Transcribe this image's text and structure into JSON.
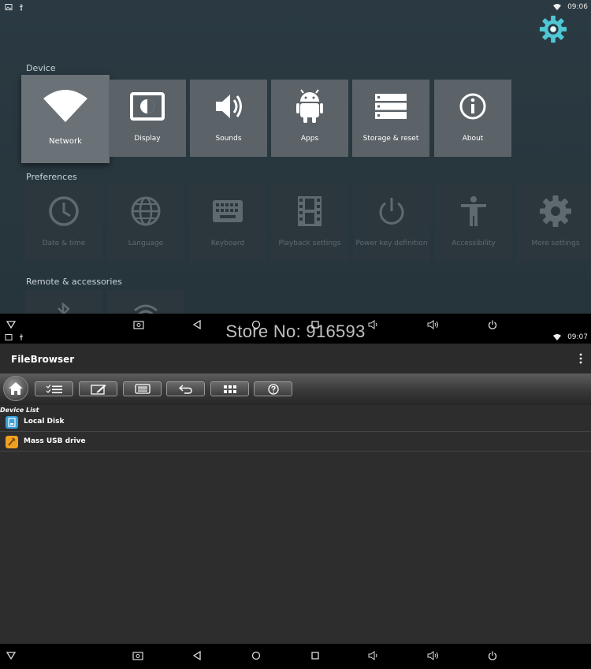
{
  "top_screen": {
    "status": {
      "time": "09:06"
    },
    "sections": {
      "device": "Device",
      "preferences": "Preferences",
      "remote": "Remote & accessories"
    },
    "device_tiles": [
      {
        "label": "Network",
        "icon": "wifi-icon"
      },
      {
        "label": "Display",
        "icon": "display-icon"
      },
      {
        "label": "Sounds",
        "icon": "speaker-icon"
      },
      {
        "label": "Apps",
        "icon": "android-icon"
      },
      {
        "label": "Storage & reset",
        "icon": "storage-icon"
      },
      {
        "label": "About",
        "icon": "info-icon"
      }
    ],
    "preference_tiles": [
      {
        "label": "Date & time",
        "icon": "clock-icon"
      },
      {
        "label": "Language",
        "icon": "globe-icon"
      },
      {
        "label": "Keyboard",
        "icon": "keyboard-icon"
      },
      {
        "label": "Playback settings",
        "icon": "film-icon"
      },
      {
        "label": "Power key definition",
        "icon": "power-icon"
      },
      {
        "label": "Accessibility",
        "icon": "accessibility-icon"
      },
      {
        "label": "More settings",
        "icon": "gear-icon"
      }
    ]
  },
  "watermark": "Store No: 916593",
  "bottom_screen": {
    "status": {
      "time": "09:07"
    },
    "app_title": "FileBrowser",
    "device_list_label": "Device List",
    "devices": [
      {
        "label": "Local Disk",
        "icon": "disk-icon",
        "color": "#3aa0d8"
      },
      {
        "label": "Mass USB drive",
        "icon": "usb-drive-icon",
        "color": "#f0a020"
      }
    ],
    "toolbar_icons": [
      "home-icon",
      "checklist-icon",
      "edit-icon",
      "list-icon",
      "undo-icon",
      "grid-icon",
      "help-icon"
    ]
  },
  "colors": {
    "tile": "#5b6368",
    "tile_dim": "#2c373d",
    "settings_bg": "#2b3a42",
    "teal_gear": "#4fc7d4"
  }
}
